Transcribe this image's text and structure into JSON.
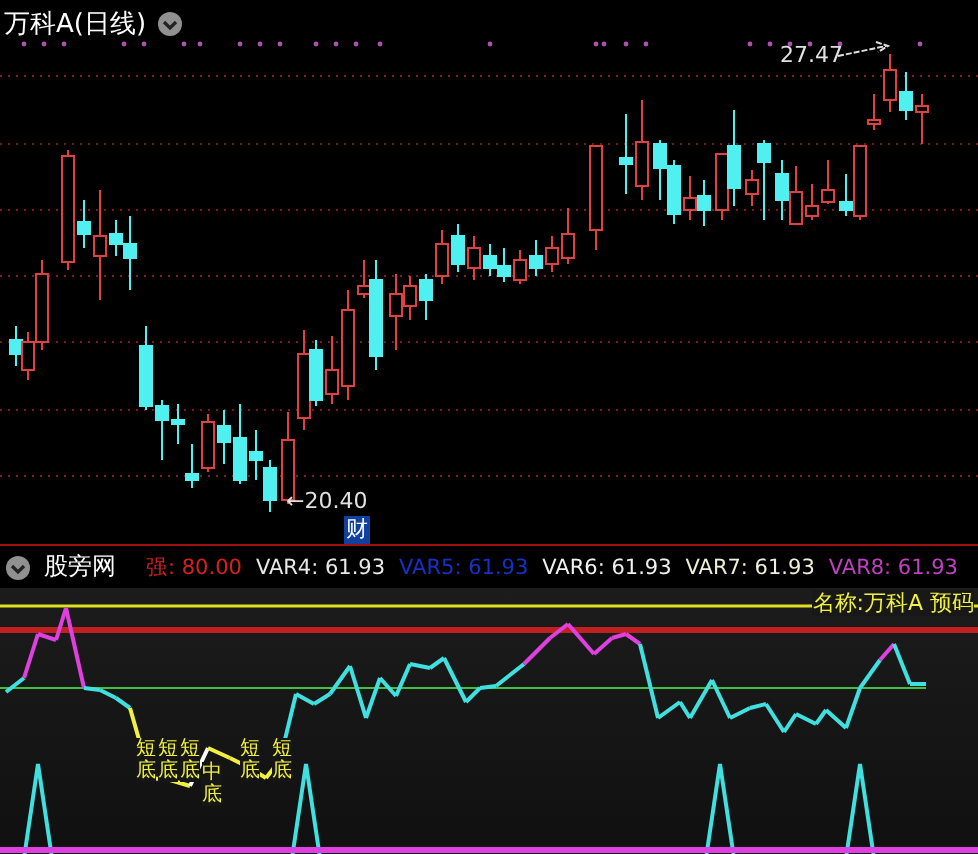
{
  "chart": {
    "title": "万科A(日线)",
    "high_label": "27.47",
    "low_label": "←20.40",
    "badge": "财"
  },
  "indicator": {
    "name": "股旁网",
    "values": [
      {
        "label": "强:",
        "value": "80.00",
        "color": "#d82020"
      },
      {
        "label": "VAR4:",
        "value": "61.93",
        "color": "#e8e8e8"
      },
      {
        "label": "VAR5:",
        "value": "61.93",
        "color": "#1830c8"
      },
      {
        "label": "VAR6:",
        "value": "61.93",
        "color": "#f0f0f0"
      },
      {
        "label": "VAR7:",
        "value": "61.93",
        "color": "#f0f0d8"
      },
      {
        "label": "VAR8:",
        "value": "61.93",
        "color": "#c040c0"
      }
    ],
    "caption": "名称:万科A 预码",
    "signals": [
      {
        "text": "短底"
      },
      {
        "text": "短底"
      },
      {
        "text": "短底"
      },
      {
        "text": "中底"
      },
      {
        "text": "短底"
      },
      {
        "text": "短底"
      }
    ]
  }
}
